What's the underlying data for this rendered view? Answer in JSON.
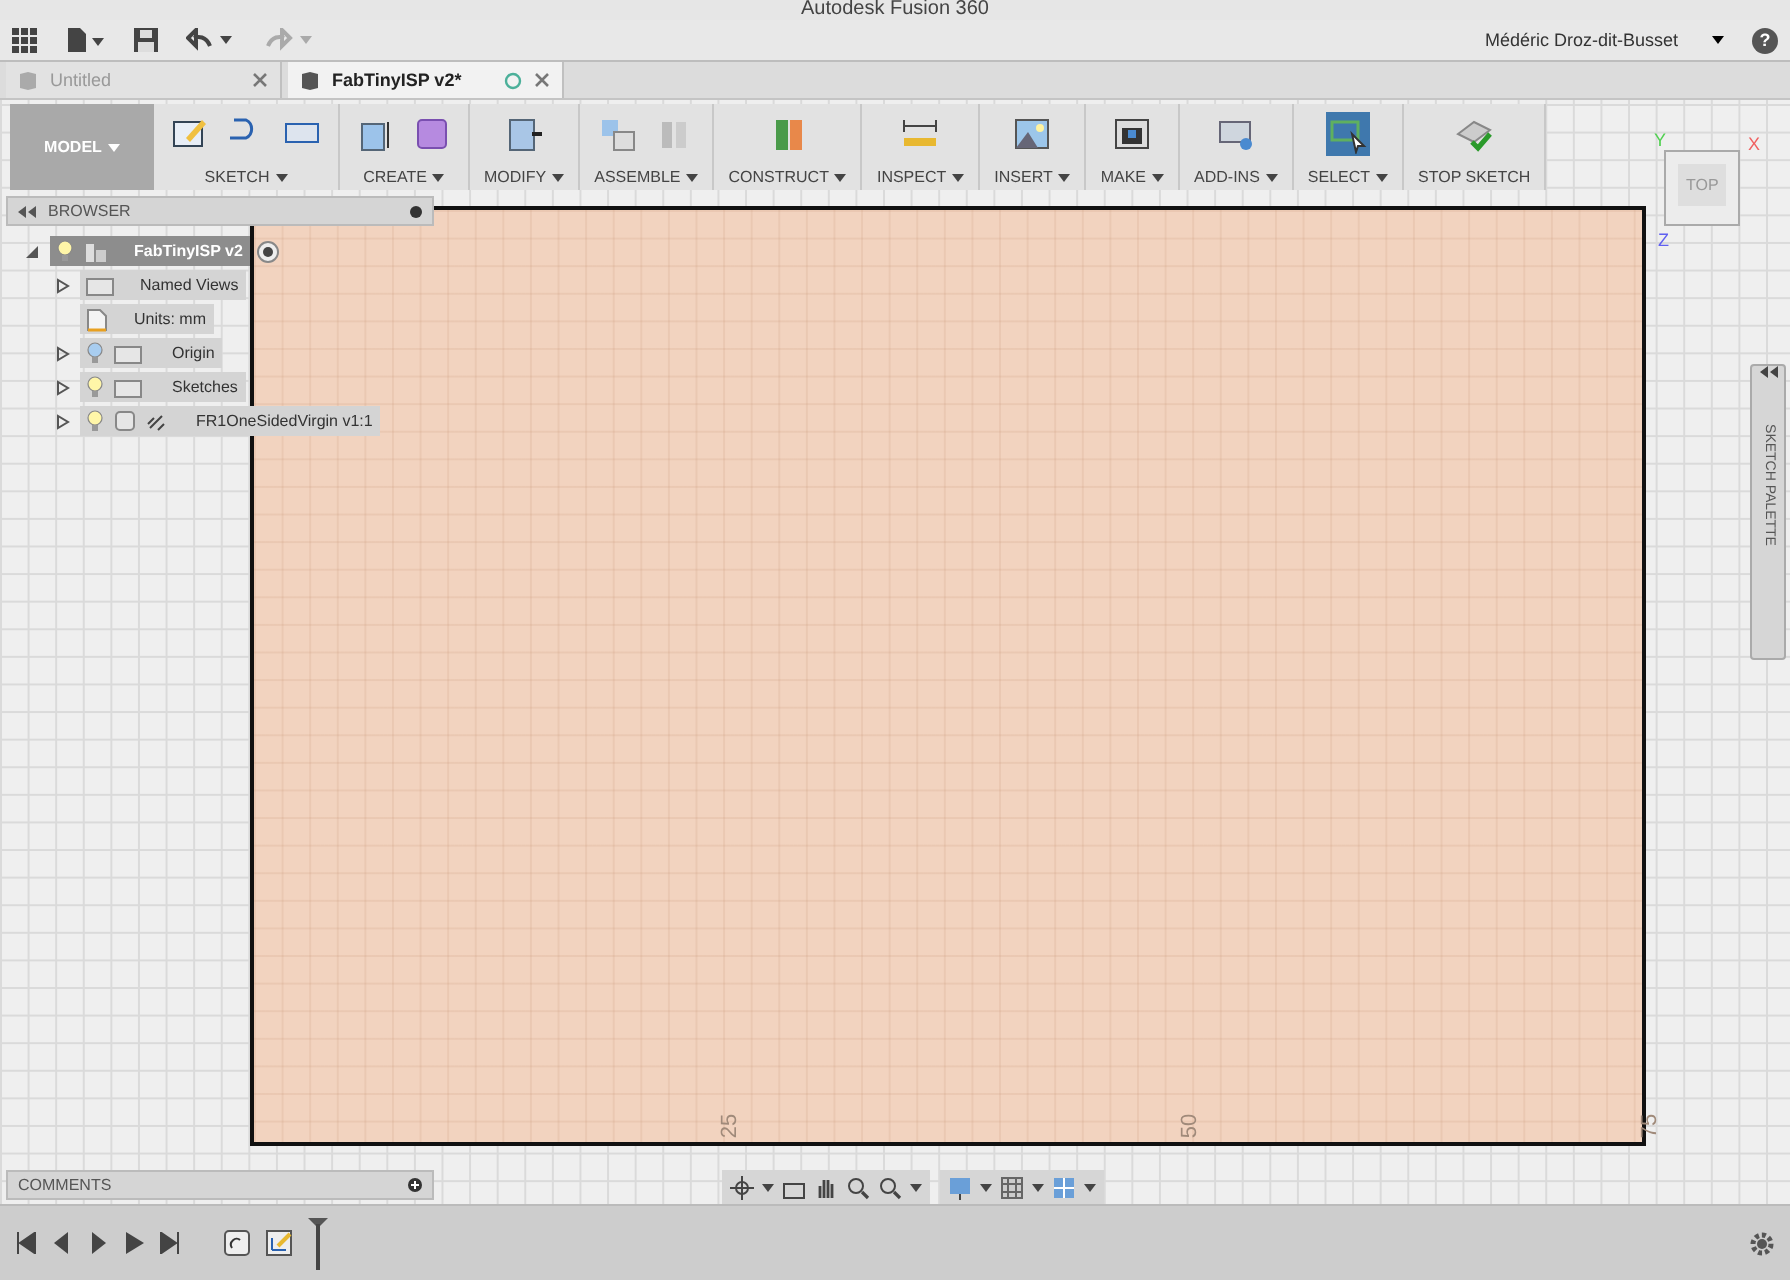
{
  "window": {
    "title": "Autodesk Fusion 360"
  },
  "app_bar": {
    "user": "Médéric Droz-dit-Busset",
    "help": "?"
  },
  "tabs": [
    {
      "label": "Untitled",
      "selected": false,
      "unsaved": false
    },
    {
      "label": "FabTinyISP v2*",
      "selected": true,
      "unsaved": true
    }
  ],
  "toolbar": {
    "mode": "MODEL",
    "groups": [
      {
        "label": "SKETCH",
        "active": false
      },
      {
        "label": "CREATE",
        "active": false
      },
      {
        "label": "MODIFY",
        "active": false
      },
      {
        "label": "ASSEMBLE",
        "active": false
      },
      {
        "label": "CONSTRUCT",
        "active": false
      },
      {
        "label": "INSPECT",
        "active": false
      },
      {
        "label": "INSERT",
        "active": false
      },
      {
        "label": "MAKE",
        "active": false
      },
      {
        "label": "ADD-INS",
        "active": false
      },
      {
        "label": "SELECT",
        "active": true
      },
      {
        "label": "STOP SKETCH",
        "active": false
      }
    ]
  },
  "browser": {
    "title": "BROWSER",
    "root": {
      "label": "FabTinyISP v2",
      "expanded": true,
      "selected": true,
      "children": [
        {
          "label": "Named Views",
          "kind": "folder",
          "expandable": true,
          "selected": false
        },
        {
          "label": "Units: mm",
          "kind": "units",
          "expandable": false,
          "selected": false
        },
        {
          "label": "Origin",
          "kind": "folder",
          "expandable": true,
          "visible": false,
          "selected": false
        },
        {
          "label": "Sketches",
          "kind": "folder",
          "expandable": true,
          "visible": true,
          "selected": false
        },
        {
          "label": "FR1OneSidedVirgin v1:1",
          "kind": "component",
          "expandable": true,
          "visible": true,
          "selected": false
        }
      ]
    }
  },
  "canvas": {
    "ruler_labels": [
      "25",
      "50",
      "75"
    ]
  },
  "viewcube": {
    "face": "TOP",
    "axes": [
      "Y",
      "X",
      "Z"
    ]
  },
  "sketch_palette": {
    "title": "SKETCH PALETTE"
  },
  "comments": {
    "title": "COMMENTS"
  }
}
